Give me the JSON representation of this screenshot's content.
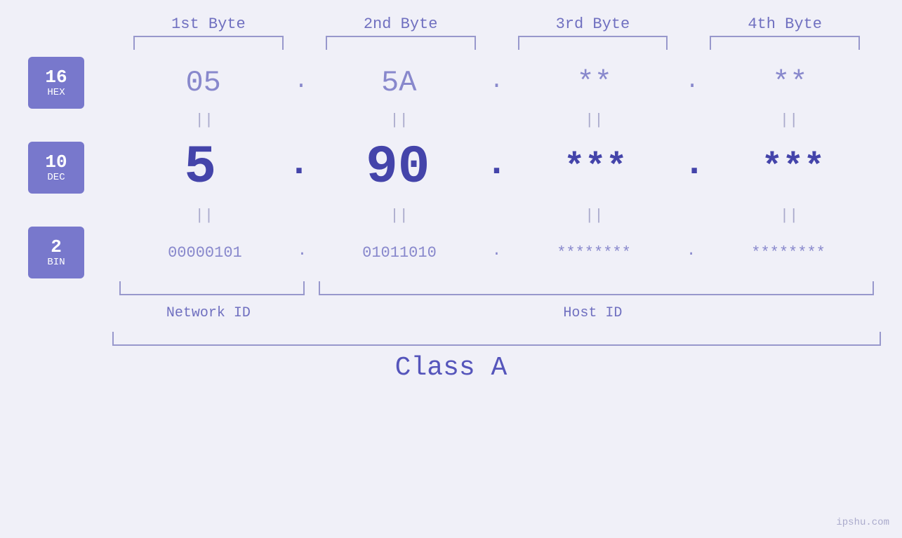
{
  "bytes": {
    "headers": [
      "1st Byte",
      "2nd Byte",
      "3rd Byte",
      "4th Byte"
    ]
  },
  "badges": [
    {
      "num": "16",
      "label": "HEX"
    },
    {
      "num": "10",
      "label": "DEC"
    },
    {
      "num": "2",
      "label": "BIN"
    }
  ],
  "hex": {
    "b1": "05",
    "b2": "5A",
    "b3": "**",
    "b4": "**",
    "d1": ".",
    "d2": ".",
    "d3": ".",
    "d4": ""
  },
  "dec": {
    "b1": "5",
    "b2": "90",
    "b3": "***",
    "b4": "***",
    "d1": ".",
    "d2": ".",
    "d3": ".",
    "d4": ""
  },
  "bin": {
    "b1": "00000101",
    "b2": "01011010",
    "b3": "********",
    "b4": "********",
    "d1": ".",
    "d2": ".",
    "d3": ".",
    "d4": ""
  },
  "labels": {
    "network_id": "Network ID",
    "host_id": "Host ID",
    "class": "Class A",
    "watermark": "ipshu.com"
  },
  "equals": "||"
}
